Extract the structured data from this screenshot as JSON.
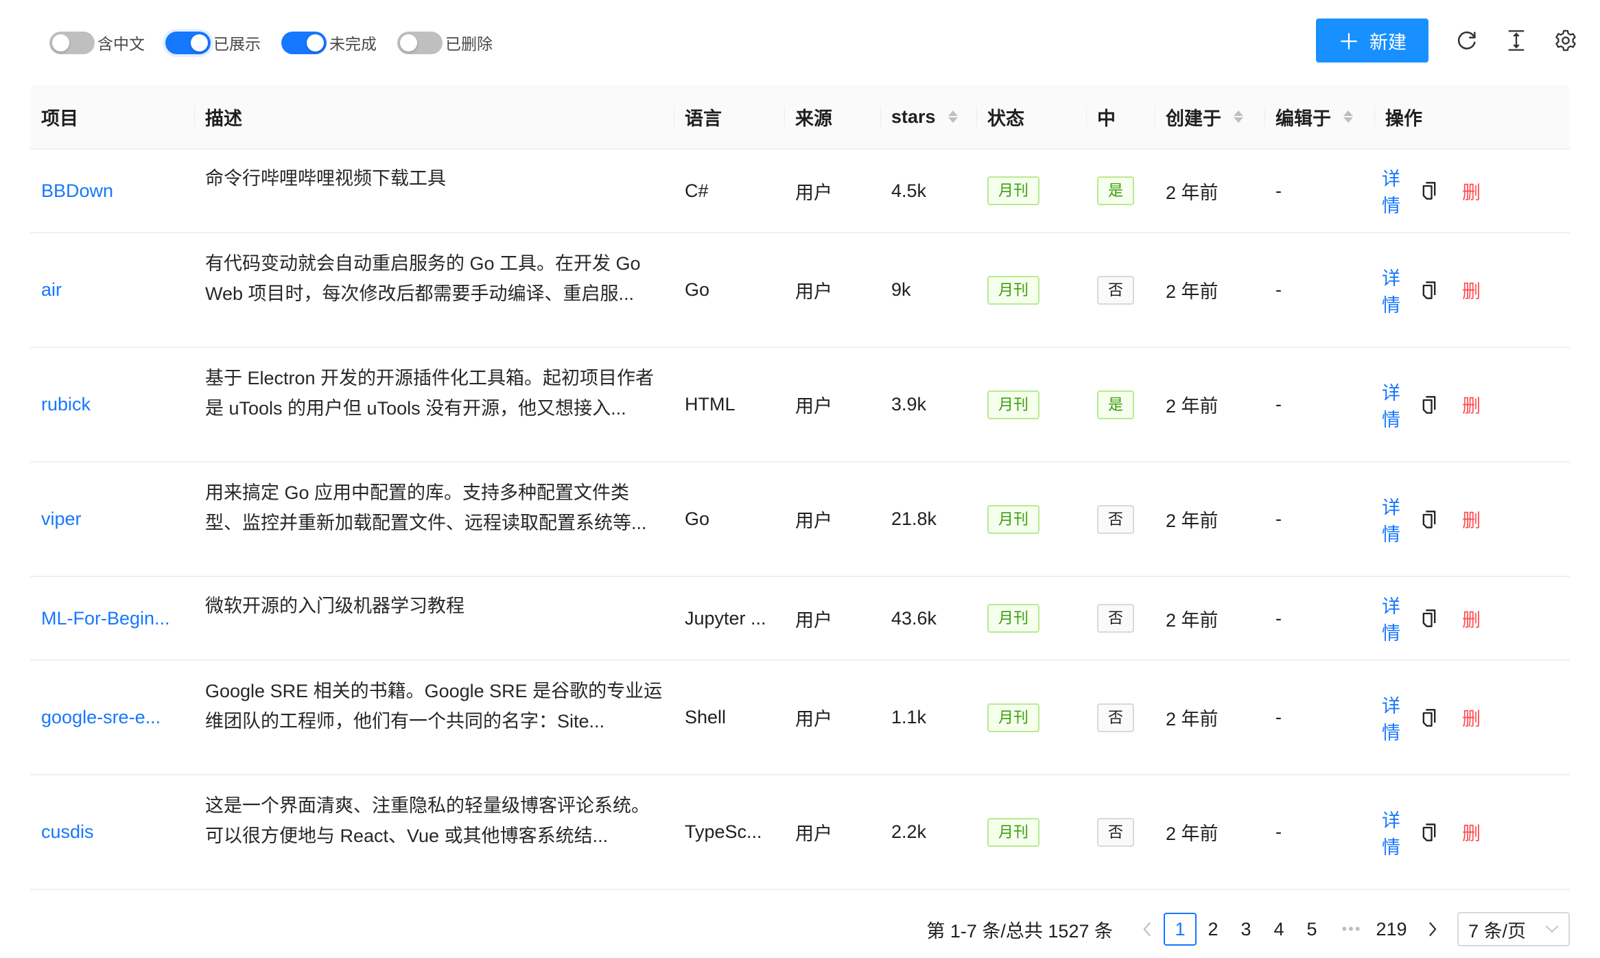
{
  "toolbar": {
    "toggles": [
      {
        "label": "含中文",
        "on": false
      },
      {
        "label": "已展示",
        "on": true
      },
      {
        "label": "未完成",
        "on": true
      },
      {
        "label": "已删除",
        "on": false
      }
    ],
    "new_button": {
      "icon": "plus-icon",
      "label": "新建"
    },
    "icons": [
      "reload-icon",
      "column-height-icon",
      "setting-icon"
    ]
  },
  "table": {
    "columns": [
      {
        "key": "project",
        "label": "项目",
        "sortable": false
      },
      {
        "key": "desc",
        "label": "描述",
        "sortable": false
      },
      {
        "key": "lang",
        "label": "语言",
        "sortable": false
      },
      {
        "key": "source",
        "label": "来源",
        "sortable": false
      },
      {
        "key": "stars",
        "label": "stars",
        "sortable": true
      },
      {
        "key": "status",
        "label": "状态",
        "sortable": false
      },
      {
        "key": "zh",
        "label": "中",
        "sortable": false
      },
      {
        "key": "created",
        "label": "创建于",
        "sortable": true
      },
      {
        "key": "edited",
        "label": "编辑于",
        "sortable": true
      },
      {
        "key": "ops",
        "label": "操作",
        "sortable": false
      }
    ],
    "rows": [
      {
        "project": "BBDown",
        "desc": "命令行哔哩哔哩视频下载工具",
        "lang": "C#",
        "source": "用户",
        "stars": "4.5k",
        "status": "月刊",
        "zh": "是",
        "zh_positive": true,
        "created": "2 年前",
        "edited": "-"
      },
      {
        "project": "air",
        "desc": "有代码变动就会自动重启服务的 Go 工具。在开发 Go Web 项目时，每次修改后都需要手动编译、重启服...",
        "lang": "Go",
        "source": "用户",
        "stars": "9k",
        "status": "月刊",
        "zh": "否",
        "zh_positive": false,
        "created": "2 年前",
        "edited": "-"
      },
      {
        "project": "rubick",
        "desc": "基于 Electron 开发的开源插件化工具箱。起初项目作者是 uTools 的用户但 uTools 没有开源，他又想接入...",
        "lang": "HTML",
        "source": "用户",
        "stars": "3.9k",
        "status": "月刊",
        "zh": "是",
        "zh_positive": true,
        "created": "2 年前",
        "edited": "-"
      },
      {
        "project": "viper",
        "desc": "用来搞定 Go 应用中配置的库。支持多种配置文件类型、监控并重新加载配置文件、远程读取配置系统等...",
        "lang": "Go",
        "source": "用户",
        "stars": "21.8k",
        "status": "月刊",
        "zh": "否",
        "zh_positive": false,
        "created": "2 年前",
        "edited": "-"
      },
      {
        "project": "ML-For-Begin...",
        "desc": "微软开源的入门级机器学习教程",
        "lang": "Jupyter ...",
        "source": "用户",
        "stars": "43.6k",
        "status": "月刊",
        "zh": "否",
        "zh_positive": false,
        "created": "2 年前",
        "edited": "-"
      },
      {
        "project": "google-sre-e...",
        "desc": "Google SRE 相关的书籍。Google SRE 是谷歌的专业运维团队的工程师，他们有一个共同的名字：Site...",
        "lang": "Shell",
        "source": "用户",
        "stars": "1.1k",
        "status": "月刊",
        "zh": "否",
        "zh_positive": false,
        "created": "2 年前",
        "edited": "-"
      },
      {
        "project": "cusdis",
        "desc": "这是一个界面清爽、注重隐私的轻量级博客评论系统。可以很方便地与 React、Vue 或其他博客系统结...",
        "lang": "TypeSc...",
        "source": "用户",
        "stars": "2.2k",
        "status": "月刊",
        "zh": "否",
        "zh_positive": false,
        "created": "2 年前",
        "edited": "-"
      }
    ],
    "row_actions": {
      "detail": "详情",
      "copy_icon": "copy-icon",
      "delete": "删"
    }
  },
  "pagination": {
    "total_text": "第 1-7 条/总共 1527 条",
    "pages": [
      "1",
      "2",
      "3",
      "4",
      "5"
    ],
    "current": "1",
    "ellipsis": "•••",
    "last": "219",
    "page_size": "7 条/页"
  },
  "colors": {
    "primary": "#1677ff",
    "success_tag": "#389e0d",
    "danger": "#ff4d4f"
  }
}
